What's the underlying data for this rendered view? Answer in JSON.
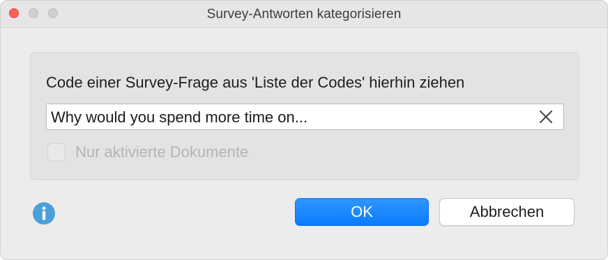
{
  "window": {
    "title": "Survey-Antworten kategorisieren"
  },
  "group": {
    "instruction": "Code einer Survey-Frage aus 'Liste der Codes' hierhin ziehen",
    "field_value": "Why would you spend more time on...",
    "checkbox_label": "Nur aktivierte Dokumente",
    "checkbox_checked": false,
    "checkbox_enabled": false
  },
  "buttons": {
    "ok_label": "OK",
    "cancel_label": "Abbrechen"
  },
  "icons": {
    "info": "info-icon",
    "clear": "close-icon"
  },
  "colors": {
    "accent": "#0a84ff",
    "info": "#4a9fd8",
    "close_light": "#fe5f57"
  }
}
